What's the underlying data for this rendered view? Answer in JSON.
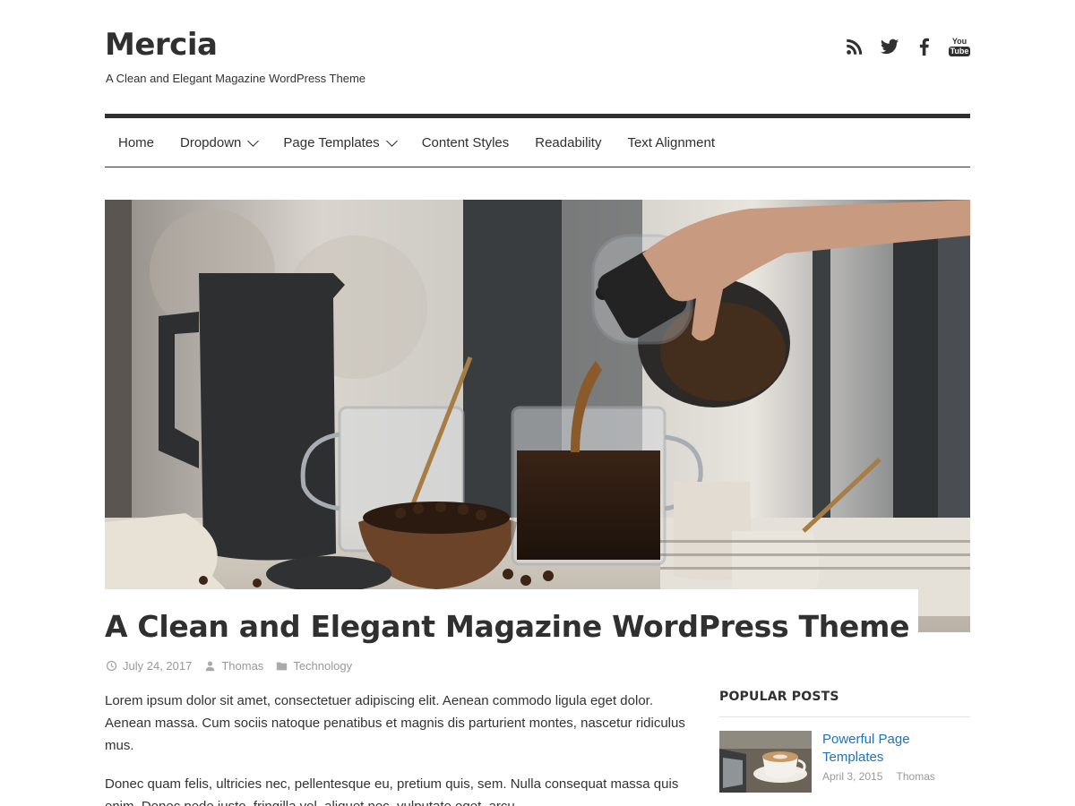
{
  "site": {
    "title": "Mercia",
    "tagline": "A Clean and Elegant Magazine WordPress Theme"
  },
  "social": [
    {
      "icon": "rss-icon"
    },
    {
      "icon": "twitter-icon"
    },
    {
      "icon": "facebook-icon"
    },
    {
      "icon": "youtube-icon",
      "label_top": "You",
      "label_bottom": "Tube"
    }
  ],
  "nav": {
    "items": [
      {
        "label": "Home"
      },
      {
        "label": "Dropdown"
      },
      {
        "label": "Page Templates"
      },
      {
        "label": "Content Styles"
      },
      {
        "label": "Readability"
      },
      {
        "label": "Text Alignment"
      }
    ]
  },
  "post": {
    "title": "A Clean and Elegant Magazine WordPress Theme",
    "date": "July 24, 2017",
    "author": "Thomas",
    "category": "Technology",
    "paragraphs": [
      "Lorem ipsum dolor sit amet, consectetuer adipiscing elit. Aenean commodo ligula eget dolor. Aenean massa. Cum sociis natoque penatibus et magnis dis parturient montes, nascetur ridiculus mus.",
      "Donec quam felis, ultricies nec, pellentesque eu, pretium quis, sem. Nulla consequat massa quis enim. Donec pede justo, fringilla vel, aliquet nec, vulputate eget, arcu."
    ]
  },
  "sidebar": {
    "heading": "POPULAR POSTS",
    "posts": [
      {
        "title": "Powerful Page Templates",
        "date": "April 3, 2015",
        "author": "Thomas"
      }
    ]
  },
  "colors": {
    "text": "#303030",
    "link": "#1e73be",
    "meta": "#999999"
  }
}
